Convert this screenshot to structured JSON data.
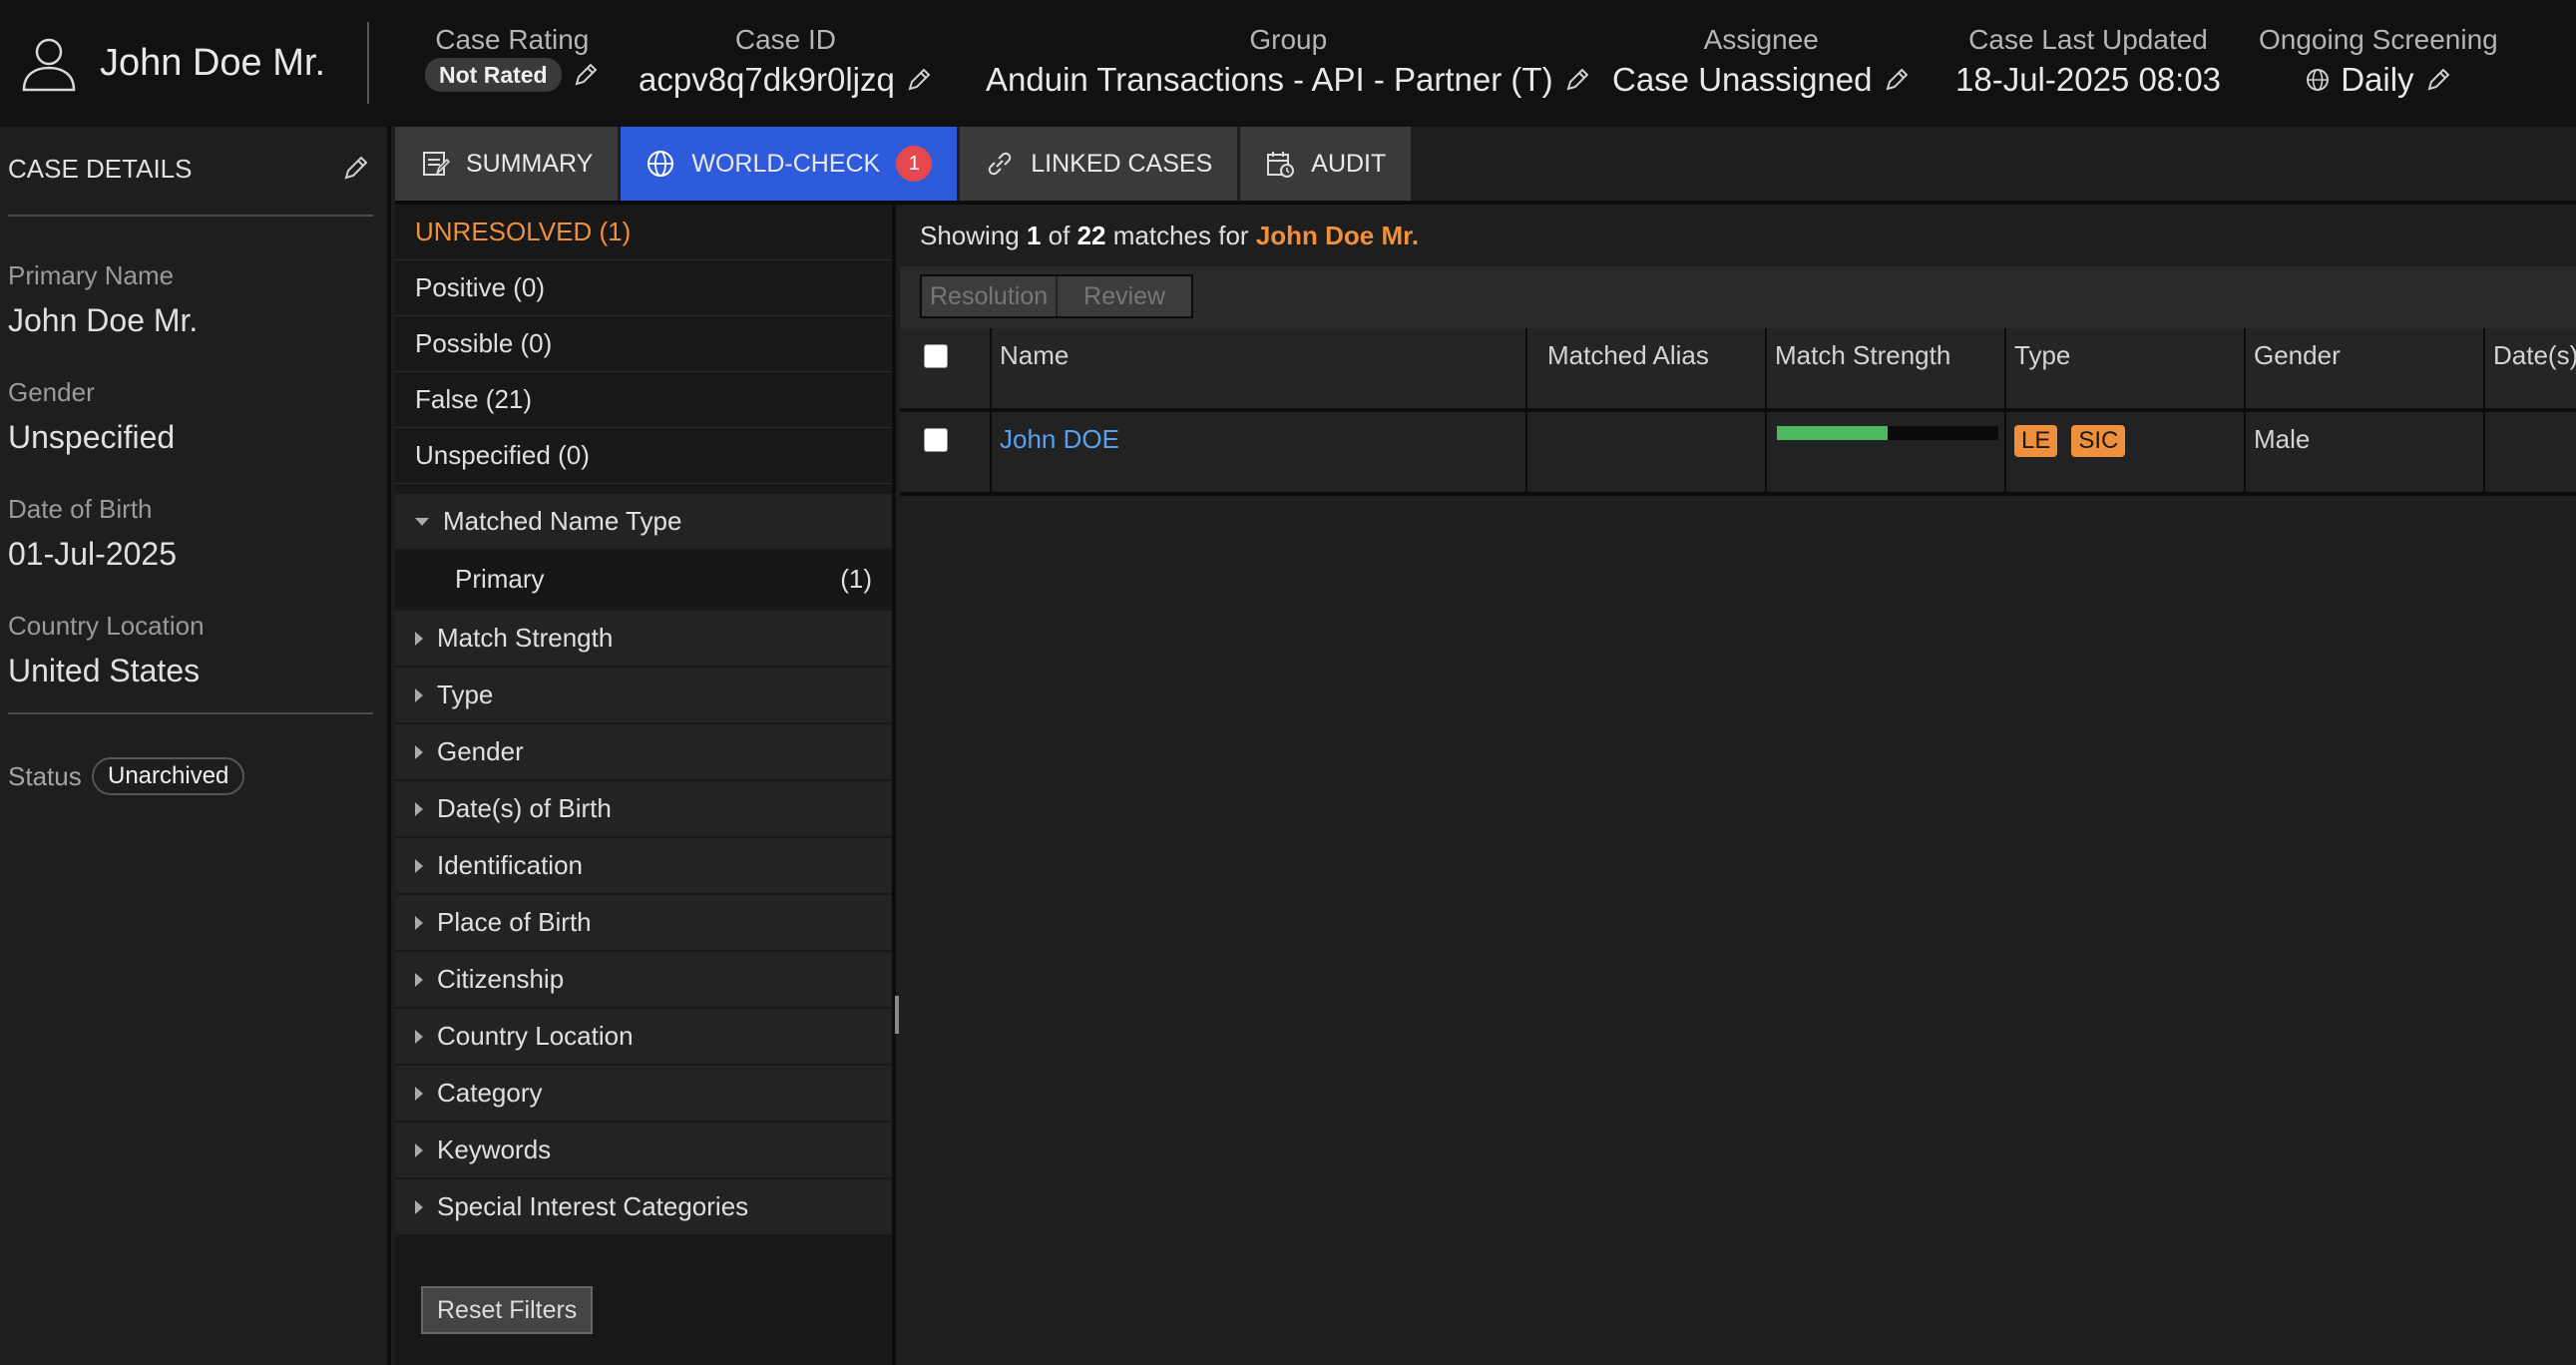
{
  "header": {
    "user_name": "John Doe Mr.",
    "case_rating": {
      "label": "Case Rating",
      "value": "Not Rated"
    },
    "case_id": {
      "label": "Case ID",
      "value": "acpv8q7dk9r0ljzq"
    },
    "group": {
      "label": "Group",
      "value": "Anduin Transactions - API - Partner (T)"
    },
    "assignee": {
      "label": "Assignee",
      "value": "Case Unassigned"
    },
    "last_updated": {
      "label": "Case Last Updated",
      "value": "18-Jul-2025 08:03"
    },
    "screening": {
      "label": "Ongoing Screening",
      "value": "Daily"
    }
  },
  "case_details": {
    "title": "CASE DETAILS",
    "primary_name": {
      "label": "Primary Name",
      "value": "John Doe Mr."
    },
    "gender": {
      "label": "Gender",
      "value": "Unspecified"
    },
    "dob": {
      "label": "Date of Birth",
      "value": "01-Jul-2025"
    },
    "country": {
      "label": "Country Location",
      "value": "United States"
    },
    "status": {
      "label": "Status",
      "value": "Unarchived"
    }
  },
  "tabs": [
    {
      "label": "SUMMARY",
      "icon": "summary-icon"
    },
    {
      "label": "WORLD-CHECK",
      "icon": "globe-icon",
      "badge": "1",
      "active": true
    },
    {
      "label": "LINKED CASES",
      "icon": "link-icon"
    },
    {
      "label": "AUDIT",
      "icon": "audit-icon"
    }
  ],
  "filters": {
    "statuses": [
      "UNRESOLVED (1)",
      "Positive (0)",
      "Possible (0)",
      "False (21)",
      "Unspecified (0)"
    ],
    "matched_name_type": {
      "label": "Matched Name Type",
      "sub_label": "Primary",
      "sub_count": "(1)"
    },
    "groups": [
      "Match Strength",
      "Type",
      "Gender",
      "Date(s) of Birth",
      "Identification",
      "Place of Birth",
      "Citizenship",
      "Country Location",
      "Category",
      "Keywords",
      "Special Interest Categories"
    ],
    "reset_label": "Reset Filters"
  },
  "results": {
    "showing_prefix": "Showing",
    "showing_current": "1",
    "showing_of": "of",
    "showing_total": "22",
    "showing_mid": "matches for",
    "query": "John Doe Mr.",
    "actions": {
      "resolution": "Resolution",
      "review": "Review"
    },
    "columns": {
      "name": "Name",
      "alias": "Matched Alias",
      "strength": "Match Strength",
      "type": "Type",
      "gender": "Gender",
      "dob": "Date(s)"
    },
    "rows": [
      {
        "name": "John DOE",
        "alias": "",
        "strength_fraction": 0.5,
        "types": [
          "LE",
          "SIC"
        ],
        "gender": "Male",
        "dob": ""
      }
    ]
  },
  "colors": {
    "accent": "#2e5bdc",
    "orange": "#f0903c",
    "link": "#5aa0f0",
    "strength": "#4cb860",
    "badge": "#e5484d"
  }
}
